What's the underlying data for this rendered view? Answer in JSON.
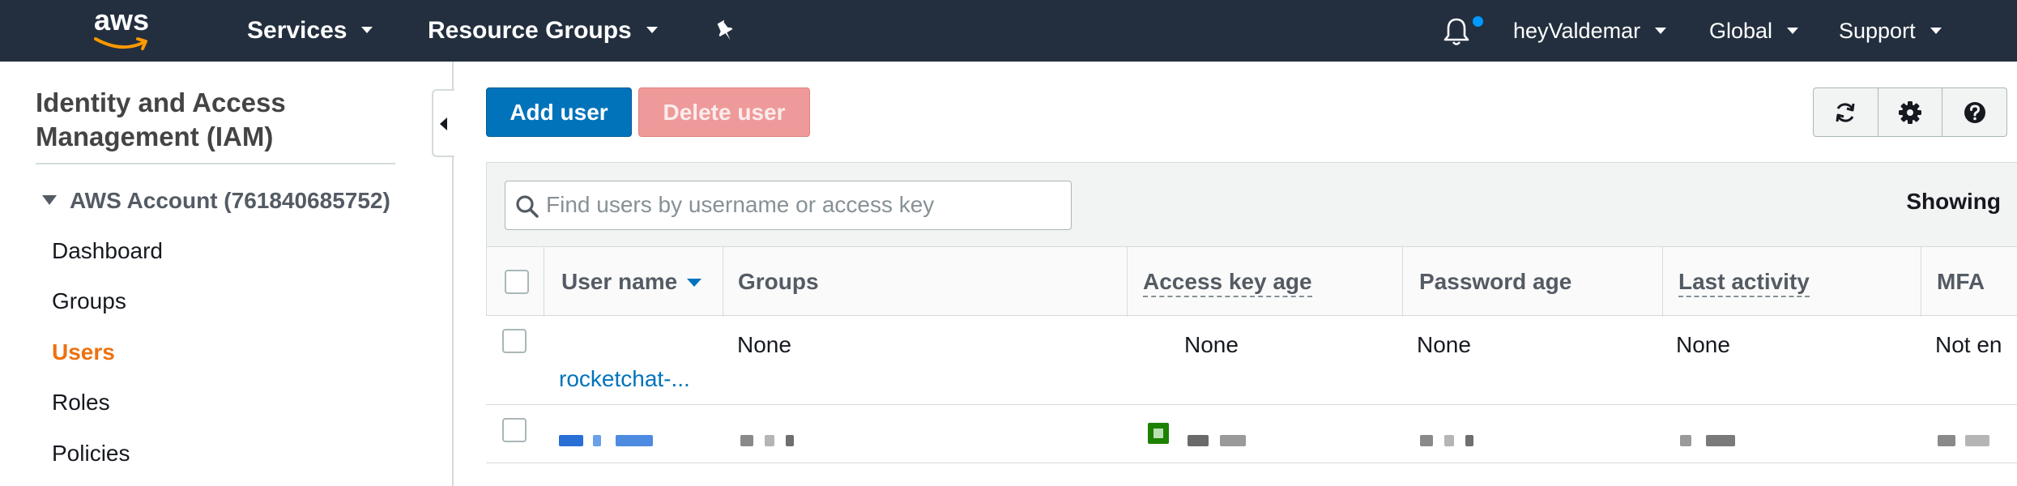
{
  "topnav": {
    "logo_text": "aws",
    "services": "Services",
    "resource_groups": "Resource Groups",
    "user": "heyValdemar",
    "region": "Global",
    "support": "Support"
  },
  "sidebar": {
    "title": "Identity and Access Management (IAM)",
    "account": "AWS Account (761840685752)",
    "items": [
      {
        "label": "Dashboard",
        "active": false
      },
      {
        "label": "Groups",
        "active": false
      },
      {
        "label": "Users",
        "active": true
      },
      {
        "label": "Roles",
        "active": false
      },
      {
        "label": "Policies",
        "active": false
      }
    ]
  },
  "toolbar": {
    "add_user": "Add user",
    "delete_user": "Delete user",
    "icons": [
      "refresh-icon",
      "gear-icon",
      "help-icon"
    ]
  },
  "search": {
    "placeholder": "Find users by username or access key",
    "value": "",
    "showing": "Showing"
  },
  "table": {
    "columns": [
      "User name",
      "Groups",
      "Access key age",
      "Password age",
      "Last activity",
      "MFA"
    ],
    "rows": [
      {
        "user_name": "rocketchat-...",
        "groups": "None",
        "access_key_age": "None",
        "password_age": "None",
        "last_activity": "None",
        "mfa": "Not en"
      }
    ]
  },
  "colors": {
    "nav_bg": "#232f3e",
    "primary": "#0073bb",
    "danger_disabled": "#ee9a9a",
    "active_nav": "#ec7211",
    "status_ok": "#1d8102"
  }
}
